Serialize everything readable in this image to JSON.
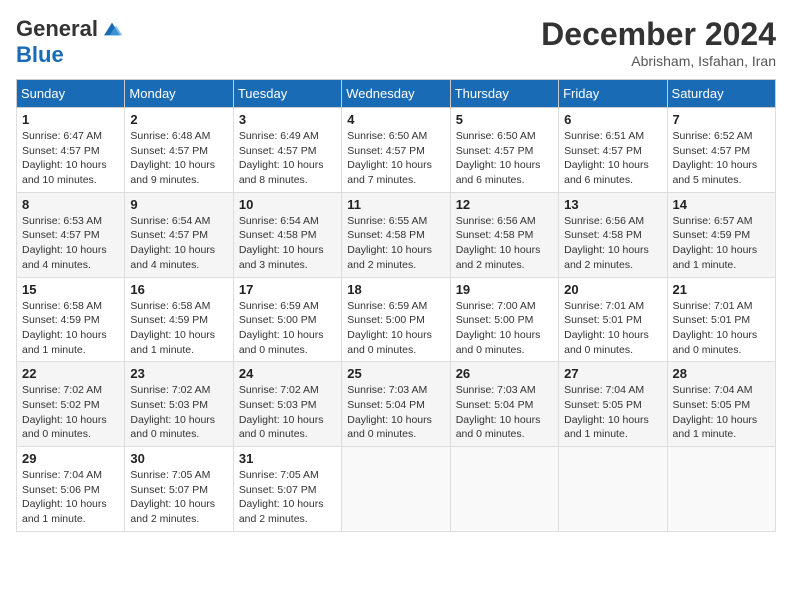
{
  "logo": {
    "general": "General",
    "blue": "Blue"
  },
  "title": "December 2024",
  "location": "Abrisham, Isfahan, Iran",
  "days_header": [
    "Sunday",
    "Monday",
    "Tuesday",
    "Wednesday",
    "Thursday",
    "Friday",
    "Saturday"
  ],
  "weeks": [
    [
      {
        "day": "1",
        "sunrise": "6:47 AM",
        "sunset": "4:57 PM",
        "daylight": "10 hours and 10 minutes."
      },
      {
        "day": "2",
        "sunrise": "6:48 AM",
        "sunset": "4:57 PM",
        "daylight": "10 hours and 9 minutes."
      },
      {
        "day": "3",
        "sunrise": "6:49 AM",
        "sunset": "4:57 PM",
        "daylight": "10 hours and 8 minutes."
      },
      {
        "day": "4",
        "sunrise": "6:50 AM",
        "sunset": "4:57 PM",
        "daylight": "10 hours and 7 minutes."
      },
      {
        "day": "5",
        "sunrise": "6:50 AM",
        "sunset": "4:57 PM",
        "daylight": "10 hours and 6 minutes."
      },
      {
        "day": "6",
        "sunrise": "6:51 AM",
        "sunset": "4:57 PM",
        "daylight": "10 hours and 6 minutes."
      },
      {
        "day": "7",
        "sunrise": "6:52 AM",
        "sunset": "4:57 PM",
        "daylight": "10 hours and 5 minutes."
      }
    ],
    [
      {
        "day": "8",
        "sunrise": "6:53 AM",
        "sunset": "4:57 PM",
        "daylight": "10 hours and 4 minutes."
      },
      {
        "day": "9",
        "sunrise": "6:54 AM",
        "sunset": "4:57 PM",
        "daylight": "10 hours and 4 minutes."
      },
      {
        "day": "10",
        "sunrise": "6:54 AM",
        "sunset": "4:58 PM",
        "daylight": "10 hours and 3 minutes."
      },
      {
        "day": "11",
        "sunrise": "6:55 AM",
        "sunset": "4:58 PM",
        "daylight": "10 hours and 2 minutes."
      },
      {
        "day": "12",
        "sunrise": "6:56 AM",
        "sunset": "4:58 PM",
        "daylight": "10 hours and 2 minutes."
      },
      {
        "day": "13",
        "sunrise": "6:56 AM",
        "sunset": "4:58 PM",
        "daylight": "10 hours and 2 minutes."
      },
      {
        "day": "14",
        "sunrise": "6:57 AM",
        "sunset": "4:59 PM",
        "daylight": "10 hours and 1 minute."
      }
    ],
    [
      {
        "day": "15",
        "sunrise": "6:58 AM",
        "sunset": "4:59 PM",
        "daylight": "10 hours and 1 minute."
      },
      {
        "day": "16",
        "sunrise": "6:58 AM",
        "sunset": "4:59 PM",
        "daylight": "10 hours and 1 minute."
      },
      {
        "day": "17",
        "sunrise": "6:59 AM",
        "sunset": "5:00 PM",
        "daylight": "10 hours and 0 minutes."
      },
      {
        "day": "18",
        "sunrise": "6:59 AM",
        "sunset": "5:00 PM",
        "daylight": "10 hours and 0 minutes."
      },
      {
        "day": "19",
        "sunrise": "7:00 AM",
        "sunset": "5:00 PM",
        "daylight": "10 hours and 0 minutes."
      },
      {
        "day": "20",
        "sunrise": "7:01 AM",
        "sunset": "5:01 PM",
        "daylight": "10 hours and 0 minutes."
      },
      {
        "day": "21",
        "sunrise": "7:01 AM",
        "sunset": "5:01 PM",
        "daylight": "10 hours and 0 minutes."
      }
    ],
    [
      {
        "day": "22",
        "sunrise": "7:02 AM",
        "sunset": "5:02 PM",
        "daylight": "10 hours and 0 minutes."
      },
      {
        "day": "23",
        "sunrise": "7:02 AM",
        "sunset": "5:03 PM",
        "daylight": "10 hours and 0 minutes."
      },
      {
        "day": "24",
        "sunrise": "7:02 AM",
        "sunset": "5:03 PM",
        "daylight": "10 hours and 0 minutes."
      },
      {
        "day": "25",
        "sunrise": "7:03 AM",
        "sunset": "5:04 PM",
        "daylight": "10 hours and 0 minutes."
      },
      {
        "day": "26",
        "sunrise": "7:03 AM",
        "sunset": "5:04 PM",
        "daylight": "10 hours and 0 minutes."
      },
      {
        "day": "27",
        "sunrise": "7:04 AM",
        "sunset": "5:05 PM",
        "daylight": "10 hours and 1 minute."
      },
      {
        "day": "28",
        "sunrise": "7:04 AM",
        "sunset": "5:05 PM",
        "daylight": "10 hours and 1 minute."
      }
    ],
    [
      {
        "day": "29",
        "sunrise": "7:04 AM",
        "sunset": "5:06 PM",
        "daylight": "10 hours and 1 minute."
      },
      {
        "day": "30",
        "sunrise": "7:05 AM",
        "sunset": "5:07 PM",
        "daylight": "10 hours and 2 minutes."
      },
      {
        "day": "31",
        "sunrise": "7:05 AM",
        "sunset": "5:07 PM",
        "daylight": "10 hours and 2 minutes."
      },
      null,
      null,
      null,
      null
    ]
  ]
}
